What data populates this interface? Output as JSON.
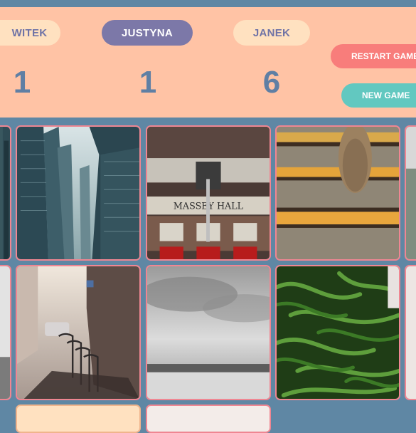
{
  "players": [
    {
      "name": "WITEK",
      "score": "1",
      "active": false
    },
    {
      "name": "JUSTYNA",
      "score": "1",
      "active": true
    },
    {
      "name": "JANEK",
      "score": "6",
      "active": false
    }
  ],
  "controls": {
    "restart_label": "RESTART GAME",
    "new_game_label": "NEW GAME"
  },
  "colors": {
    "background": "#5f87a4",
    "header": "#ffc3a5",
    "active_player": "#7c78a8",
    "inactive_player": "#ffe1c0",
    "restart": "#f87d7b",
    "new_game": "#62c8c0",
    "card_border": "#ef8692"
  },
  "cards": [
    {
      "image": "skyscrapers-photo"
    },
    {
      "image": "massey-hall-photo"
    },
    {
      "image": "striped-steps-shoe-photo"
    },
    {
      "image": "rainy-street-bicycles-photo"
    },
    {
      "image": "cloudy-sea-photo"
    },
    {
      "image": "green-beans-photo"
    }
  ]
}
